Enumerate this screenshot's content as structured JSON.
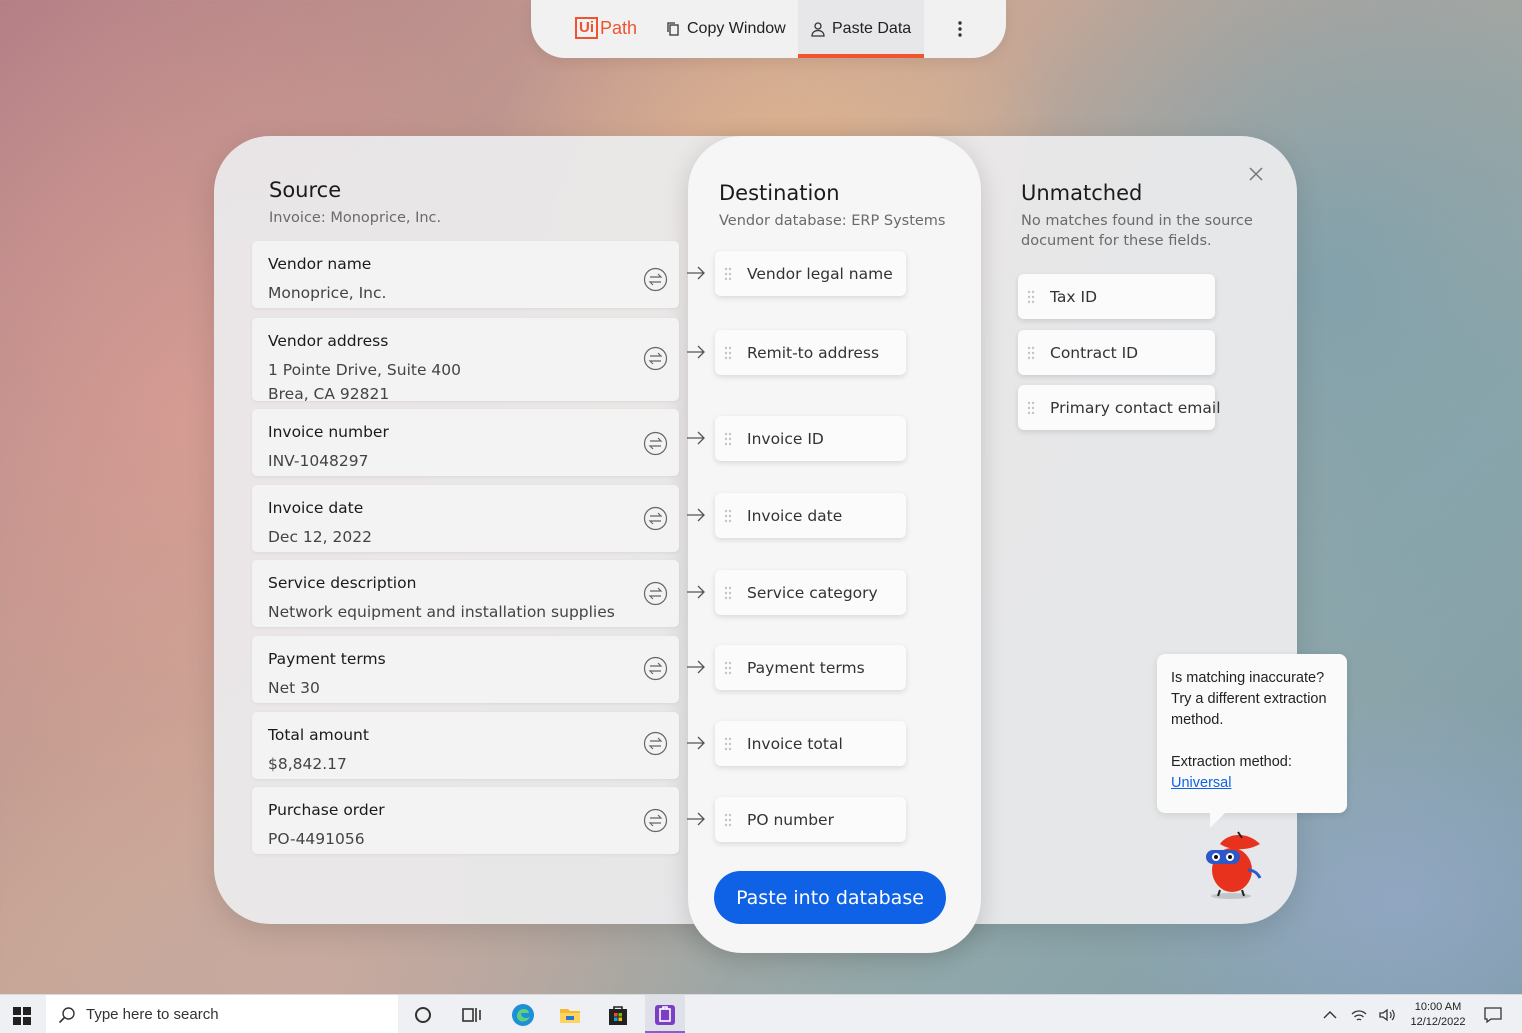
{
  "toolbar": {
    "logo_ui": "Ui",
    "logo_path": "Path",
    "copy_window_label": "Copy Window",
    "paste_data_label": "Paste Data",
    "more_icon": "more-vertical-icon"
  },
  "source": {
    "title": "Source",
    "subtitle": "Invoice: Monoprice, Inc.",
    "fields": [
      {
        "label": "Vendor name",
        "value": "Monoprice, Inc."
      },
      {
        "label": "Vendor address",
        "value": "1 Pointe Drive, Suite 400\nBrea, CA 92821"
      },
      {
        "label": "Invoice number",
        "value": "INV-1048297"
      },
      {
        "label": "Invoice date",
        "value": "Dec 12, 2022"
      },
      {
        "label": "Service description",
        "value": "Network equipment and installation supplies"
      },
      {
        "label": "Payment terms",
        "value": "Net 30"
      },
      {
        "label": "Total amount",
        "value": "$8,842.17"
      },
      {
        "label": "Purchase order",
        "value": "PO-4491056"
      }
    ]
  },
  "destination": {
    "title": "Destination",
    "subtitle": "Vendor database: ERP Systems",
    "fields": [
      "Vendor legal name",
      "Remit-to address",
      "Invoice ID",
      "Invoice date",
      "Service category",
      "Payment terms",
      "Invoice total",
      "PO number"
    ],
    "paste_button": "Paste into database"
  },
  "unmatched": {
    "title": "Unmatched",
    "subtitle": "No matches found in the source document for these fields.",
    "fields": [
      "Tax ID",
      "Contract ID",
      "Primary contact email"
    ]
  },
  "tooltip": {
    "line1": "Is matching inaccurate? Try a different extraction method.",
    "method_label": "Extraction method:",
    "method_link": "Universal"
  },
  "taskbar": {
    "search_placeholder": "Type here to search",
    "time": "10:00 AM",
    "date": "12/12/2022"
  },
  "colors": {
    "accent_orange": "#f0532f",
    "primary_blue": "#0f62e6"
  }
}
